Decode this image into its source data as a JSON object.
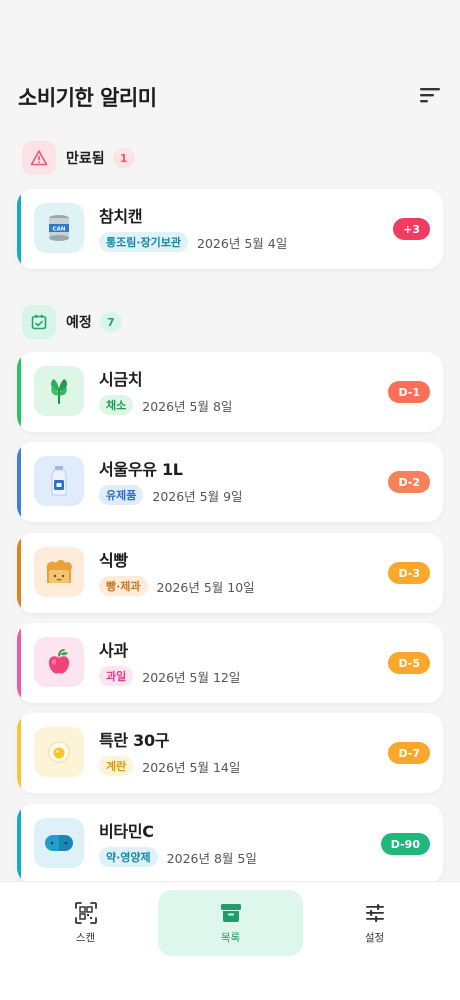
{
  "app": {
    "title": "소비기한 알리미"
  },
  "sections": {
    "expired": {
      "label": "만료됨",
      "count": "1"
    },
    "upcoming": {
      "label": "예정",
      "count": "7"
    }
  },
  "items": [
    {
      "name": "참치캔",
      "category": "통조림·장기보관",
      "date": "2026년 5월 4일",
      "dday": "+3",
      "accent": "#17a9c9",
      "badge": "#ef3c63"
    },
    {
      "name": "시금치",
      "category": "채소",
      "date": "2026년 5월 8일",
      "dday": "D-1",
      "accent": "#2fbf6a",
      "badge": "#fa6f55"
    },
    {
      "name": "서울우유 1L",
      "category": "유제품",
      "date": "2026년 5월 9일",
      "dday": "D-2",
      "accent": "#3f7fd9",
      "badge": "#f7815a"
    },
    {
      "name": "식빵",
      "category": "빵·제과",
      "date": "2026년 5월 10일",
      "dday": "D-3",
      "accent": "#d98321",
      "badge": "#f9a82b"
    },
    {
      "name": "사과",
      "category": "과일",
      "date": "2026년 5월 12일",
      "dday": "D-5",
      "accent": "#e35ea7",
      "badge": "#f9a82b"
    },
    {
      "name": "특란 30구",
      "category": "계란",
      "date": "2026년 5월 14일",
      "dday": "D-7",
      "accent": "#f4c43a",
      "badge": "#f9a82b"
    },
    {
      "name": "비타민C",
      "category": "약·영양제",
      "date": "2026년 8월 5일",
      "dday": "D-90",
      "accent": "#17a9c9",
      "badge": "#1fb87b"
    }
  ],
  "nav": {
    "scan": "스캔",
    "list": "목록",
    "settings": "설정"
  },
  "icons": {
    "sort": "sort-icon",
    "expired": "warning-triangle-icon",
    "upcoming": "calendar-check-icon",
    "scan": "qr-scan-icon",
    "list": "archive-box-icon",
    "settings": "sliders-icon"
  },
  "colors": {
    "brand": "#1f9d6c",
    "danger": "#ef3c63"
  }
}
